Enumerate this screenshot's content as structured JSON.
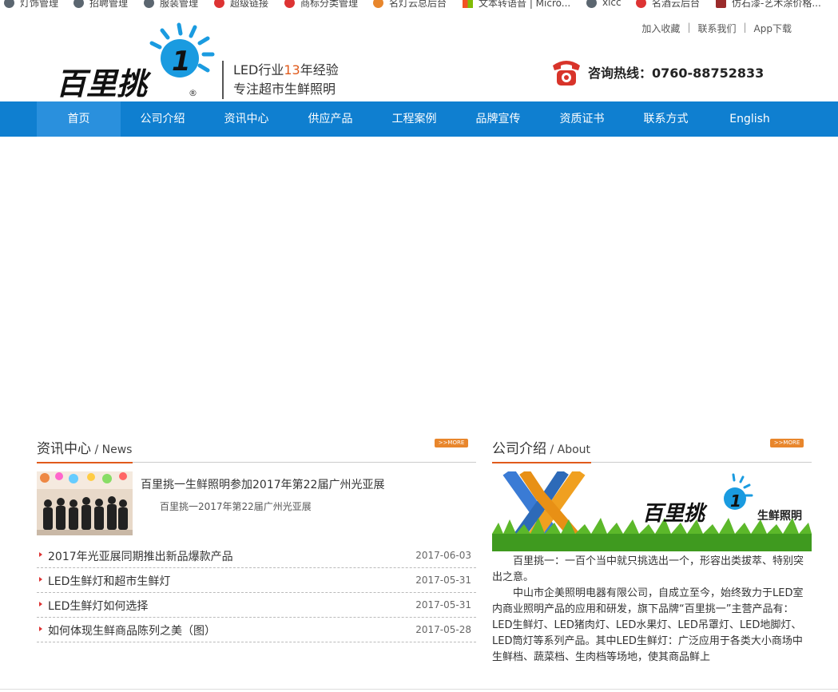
{
  "bookmarks": [
    {
      "label": "灯饰管理",
      "icon": "globe-icon"
    },
    {
      "label": "招聘管理",
      "icon": "globe-icon"
    },
    {
      "label": "服装管理",
      "icon": "globe-icon"
    },
    {
      "label": "超级链接",
      "icon": "red-pin-icon"
    },
    {
      "label": "商标分类管理",
      "icon": "red-h-icon"
    },
    {
      "label": "名灯云总后台",
      "icon": "orange-percent-icon"
    },
    {
      "label": "文本转语音 | Micro...",
      "icon": "microsoft-icon"
    },
    {
      "label": "xlcc",
      "icon": "globe-icon"
    },
    {
      "label": "名酒云后台",
      "icon": "red-percent-icon"
    },
    {
      "label": "仿石漆-艺术涂价格...",
      "icon": "book-icon"
    }
  ],
  "top_links": [
    "加入收藏",
    "联系我们",
    "App下载"
  ],
  "top_link_separator": "|",
  "logo": {
    "text": "百里挑",
    "registered": "®"
  },
  "slogan": {
    "line1_pre": "LED行业",
    "line1_hl": "13",
    "line1_post": "年经验",
    "line2": "专注超市生鲜照明"
  },
  "hotline": {
    "label": "咨询热线：0760-88752833",
    "icon": "telephone-icon"
  },
  "nav": [
    "首页",
    "公司介绍",
    "资讯中心",
    "供应产品",
    "工程案例",
    "品牌宣传",
    "资质证书",
    "联系方式",
    "English"
  ],
  "news": {
    "title": "资讯中心",
    "subtitle": " / News",
    "more": ">>MORE",
    "featured_title": "百里挑一生鲜照明参加2017年第22届广州光亚展",
    "featured_desc": "百里挑一2017年第22届广州光亚展",
    "items": [
      {
        "title": "2017年光亚展同期推出新品爆款产品",
        "date": "2017-06-03"
      },
      {
        "title": "LED生鲜灯和超市生鲜灯",
        "date": "2017-05-31"
      },
      {
        "title": "LED生鲜灯如何选择",
        "date": "2017-05-31"
      },
      {
        "title": "如何体现生鲜商品陈列之美（图）",
        "date": "2017-05-28"
      }
    ]
  },
  "about": {
    "title": "公司介绍",
    "subtitle": " / About",
    "more": ">>MORE",
    "image_brand": "百里挑",
    "image_caption": "生鲜照明",
    "p1": "百里挑一：一百个当中就只挑选出一个，形容出类拔萃、特别突出之意。",
    "p2": "中山市企美照明电器有限公司，自成立至今，始终致力于LED室内商业照明产品的应用和研发，旗下品牌“百里挑一”主营产品有：LED生鲜灯、LED猪肉灯、LED水果灯、LED吊罩灯、LED地脚灯、LED筒灯等系列产品。其中LED生鲜灯：广泛应用于各类大小商场中生鲜档、蔬菜档、生肉档等场地，使其商品鲜上"
  },
  "colors": {
    "nav_bg": "#0f7fd0",
    "nav_active": "#2a90dd",
    "accent": "#e05a1b",
    "more_btn": "#e8862c"
  }
}
